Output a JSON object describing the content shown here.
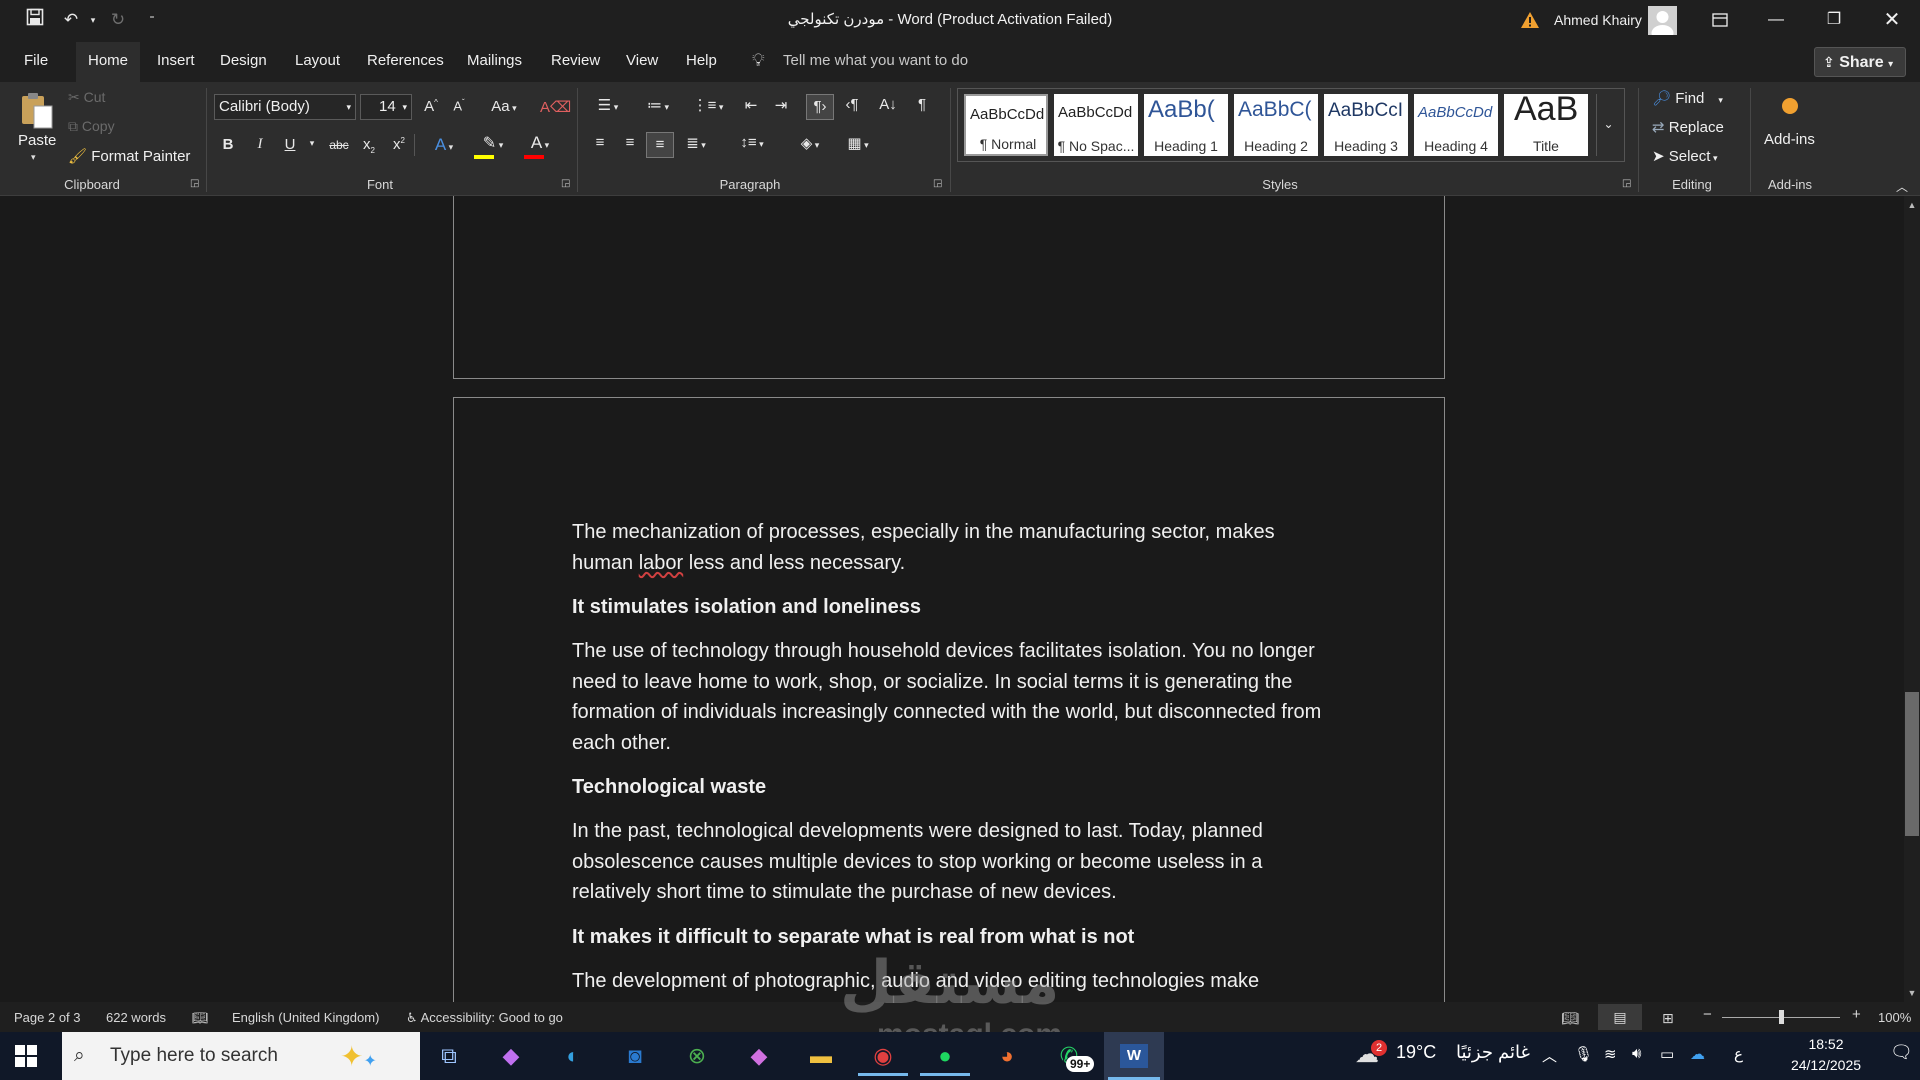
{
  "titlebar": {
    "doc_title": "مودرن تكنولجي  -  Word (Product Activation Failed)",
    "user_name": "Ahmed Khairy"
  },
  "tabs": [
    "File",
    "Home",
    "Insert",
    "Design",
    "Layout",
    "References",
    "Mailings",
    "Review",
    "View",
    "Help"
  ],
  "tell_me": "Tell me what you want to do",
  "share_label": "Share",
  "clipboard": {
    "paste": "Paste",
    "cut": "Cut",
    "copy": "Copy",
    "format_painter": "Format Painter",
    "label": "Clipboard"
  },
  "font": {
    "family": "Calibri (Body)",
    "size": "14",
    "label": "Font",
    "case": "Aa"
  },
  "paragraph": {
    "label": "Paragraph"
  },
  "styles": {
    "label": "Styles",
    "items": [
      {
        "preview": "AaBbCcDd",
        "name": "¶ Normal"
      },
      {
        "preview": "AaBbCcDd",
        "name": "¶ No Spac..."
      },
      {
        "preview": "AaBb(",
        "name": "Heading 1"
      },
      {
        "preview": "AaBbC(",
        "name": "Heading 2"
      },
      {
        "preview": "AaBbCcI",
        "name": "Heading 3"
      },
      {
        "preview": "AaBbCcDd",
        "name": "Heading 4"
      },
      {
        "preview": "AaB",
        "name": "Title"
      }
    ]
  },
  "editing": {
    "find": "Find",
    "replace": "Replace",
    "select": "Select",
    "label": "Editing"
  },
  "addins": {
    "button": "Add-ins",
    "label": "Add-ins"
  },
  "document": {
    "p1_before": "The mechanization of processes, especially in the manufacturing sector, makes human ",
    "p1_misspelled": "labor",
    "p1_after": " less and less necessary.",
    "h1": "It stimulates isolation and loneliness",
    "p2": "The use of technology through household devices facilitates isolation. You no longer need to leave home to work, shop, or socialize. In social terms it is generating the formation of individuals increasingly connected with the world, but disconnected from each other.",
    "h2": "Technological waste",
    "p3": "In the past, technological developments were designed to last. Today, planned obsolescence causes multiple devices to stop working or become useless in a relatively short time to stimulate the purchase of new devices.",
    "h3": "It makes it difficult to separate what is real from what is not",
    "p4": "The development of photographic, audio and video editing technologies make"
  },
  "status": {
    "page": "Page 2 of 3",
    "words": "622 words",
    "language": "English (United Kingdom)",
    "accessibility": "Accessibility: Good to go",
    "zoom": "100%"
  },
  "taskbar": {
    "search_placeholder": "Type here to search",
    "weather_temp": "19°C",
    "weather_desc": "غائم جزئيًا",
    "weather_badge": "2",
    "whatsapp_badge": "99+",
    "lang": "ع",
    "time": "18:52",
    "date": "24/12/2025"
  },
  "watermark": {
    "line1": "مستقل",
    "line2": "mostaql.com"
  },
  "colors": {
    "accent_highlight": "#ffff00",
    "font_color": "#ff0000",
    "word_blue": "#2b579a"
  }
}
